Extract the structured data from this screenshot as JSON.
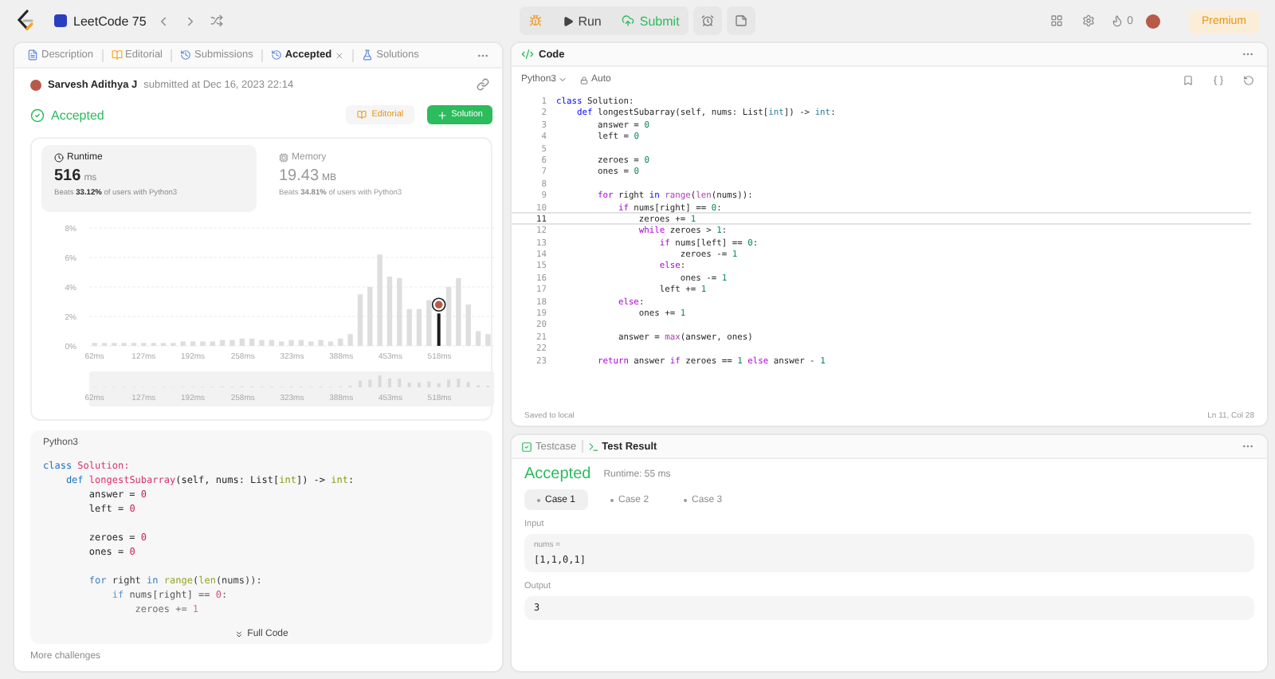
{
  "top_bar": {
    "title": "LeetCode 75",
    "run": "Run",
    "submit": "Submit",
    "streak": "0",
    "premium": "Premium"
  },
  "left_tabs": [
    {
      "label": "Description",
      "kind": "description",
      "selected": false,
      "closable": false
    },
    {
      "label": "Editorial",
      "kind": "editorial",
      "selected": false,
      "closable": false
    },
    {
      "label": "Submissions",
      "kind": "submissions",
      "selected": false,
      "closable": false
    },
    {
      "label": "Accepted",
      "kind": "accepted",
      "selected": true,
      "closable": true
    },
    {
      "label": "Solutions",
      "kind": "solutions",
      "selected": false,
      "closable": false
    }
  ],
  "submission": {
    "author": "Sarvesh Adithya J",
    "submitted": "submitted at Dec 16, 2023 22:14",
    "status": "Accepted",
    "editorial_button": "Editorial",
    "solution_button": "Solution"
  },
  "stats": [
    {
      "kind": "runtime",
      "label": "Runtime",
      "value": "516",
      "unit": "ms",
      "beats": "Beats **33.12%** of users with Python3",
      "selected": true
    },
    {
      "kind": "memory",
      "label": "Memory",
      "value": "19.43",
      "unit": "MB",
      "beats": "Beats **34.81%** of users with Python3",
      "selected": false
    }
  ],
  "runtime_chart": {
    "chart_data": {
      "type": "bar",
      "grid": true,
      "xlim": [
        55,
        590
      ],
      "ylim": [
        0,
        8
      ],
      "x": [
        62,
        75,
        88,
        101,
        114,
        127,
        140,
        153,
        166,
        179,
        192,
        205,
        218,
        231,
        244,
        257,
        270,
        283,
        296,
        309,
        322,
        335,
        348,
        361,
        374,
        387,
        400,
        413,
        426,
        439,
        452,
        465,
        478,
        491,
        504,
        517,
        530,
        543,
        556,
        569,
        582
      ],
      "series": [
        {
          "color": "#dedede",
          "values": [
            0.2,
            0.2,
            0.2,
            0.2,
            0.2,
            0.2,
            0.2,
            0.2,
            0.2,
            0.3,
            0.3,
            0.3,
            0.3,
            0.4,
            0.4,
            0.5,
            0.5,
            0.4,
            0.4,
            0.3,
            0.4,
            0.4,
            0.3,
            0.4,
            0.3,
            0.5,
            0.8,
            3.5,
            4.0,
            6.2,
            4.7,
            4.6,
            2.5,
            2.5,
            3.1,
            null,
            4.0,
            4.6,
            2.8,
            1.0,
            0.8
          ]
        },
        {
          "color": "#1a1a1a",
          "values": [
            null,
            null,
            null,
            null,
            null,
            null,
            null,
            null,
            null,
            null,
            null,
            null,
            null,
            null,
            null,
            null,
            null,
            null,
            null,
            null,
            null,
            null,
            null,
            null,
            null,
            null,
            null,
            null,
            null,
            null,
            null,
            null,
            null,
            null,
            null,
            2.2,
            null,
            null,
            null,
            null,
            null
          ]
        }
      ],
      "xticks": [
        {
          "value": 62,
          "label": "62ms"
        },
        {
          "value": 127,
          "label": "127ms"
        },
        {
          "value": 192,
          "label": "192ms"
        },
        {
          "value": 258,
          "label": "258ms"
        },
        {
          "value": 323,
          "label": "323ms"
        },
        {
          "value": 388,
          "label": "388ms"
        },
        {
          "value": 453,
          "label": "453ms"
        },
        {
          "value": 518,
          "label": "518ms"
        }
      ],
      "yticks": [
        {
          "value": 0,
          "label": "0%"
        },
        {
          "value": 2,
          "label": "2%"
        },
        {
          "value": 4,
          "label": "4%"
        },
        {
          "value": 6,
          "label": "6%"
        },
        {
          "value": 8,
          "label": "8%"
        }
      ]
    },
    "brush_labels": [
      "62ms",
      "127ms",
      "192ms",
      "258ms",
      "323ms",
      "388ms",
      "453ms",
      "518ms"
    ]
  },
  "snippet": {
    "language": "Python3",
    "expand_button": "Full Code",
    "lines": [
      {
        "kind": "code",
        "tokens": [
          {
            "text": "class",
            "kind": "keyword"
          },
          {
            "text": " Solution:",
            "kind": "class"
          }
        ]
      },
      {
        "kind": "code",
        "tokens": [
          {
            "text": "    def",
            "kind": "keyword"
          },
          {
            "text": " longestSubarray",
            "kind": "function"
          },
          {
            "text": "(self, nums: List[",
            "kind": "plain"
          },
          {
            "text": "int",
            "kind": "type"
          },
          {
            "text": "]) -> ",
            "kind": "plain"
          },
          {
            "text": "int",
            "kind": "type"
          },
          {
            "text": ":",
            "kind": "plain"
          }
        ]
      },
      {
        "kind": "code",
        "tokens": [
          {
            "text": "        answer = ",
            "kind": "plain"
          },
          {
            "text": "0",
            "kind": "number"
          }
        ]
      },
      {
        "kind": "code",
        "tokens": [
          {
            "text": "        left = ",
            "kind": "plain"
          },
          {
            "text": "0",
            "kind": "number"
          }
        ]
      },
      {
        "kind": "blank"
      },
      {
        "kind": "code",
        "tokens": [
          {
            "text": "        zeroes = ",
            "kind": "plain"
          },
          {
            "text": "0",
            "kind": "number"
          }
        ]
      },
      {
        "kind": "code",
        "tokens": [
          {
            "text": "        ones = ",
            "kind": "plain"
          },
          {
            "text": "0",
            "kind": "number"
          }
        ]
      },
      {
        "kind": "blank"
      },
      {
        "kind": "code",
        "tokens": [
          {
            "text": "        for",
            "kind": "control"
          },
          {
            "text": " right ",
            "kind": "plain"
          },
          {
            "text": "in",
            "kind": "control"
          },
          {
            "text": " range",
            "kind": "builtin"
          },
          {
            "text": "(",
            "kind": "plain"
          },
          {
            "text": "len",
            "kind": "builtin"
          },
          {
            "text": "(nums)):",
            "kind": "plain"
          }
        ]
      },
      {
        "kind": "code",
        "tokens": [
          {
            "text": "            if",
            "kind": "control"
          },
          {
            "text": " nums[right] == ",
            "kind": "plain"
          },
          {
            "text": "0",
            "kind": "number"
          },
          {
            "text": ":",
            "kind": "plain"
          }
        ]
      },
      {
        "kind": "code",
        "tokens": [
          {
            "text": "                zeroes += ",
            "kind": "plain"
          },
          {
            "text": "1",
            "kind": "number"
          }
        ]
      }
    ]
  },
  "more_link": "More challenges",
  "editor": {
    "title": "Code",
    "language": "Python3",
    "mode": "Auto",
    "status": "Saved to local",
    "cursor": "Ln 11, Col 28",
    "lines": [
      {
        "no": "1",
        "current": false,
        "tokens": [
          {
            "text": "class",
            "kind": "keyword"
          },
          {
            "text": " Solution:",
            "kind": "plain"
          }
        ]
      },
      {
        "no": "2",
        "current": false,
        "tokens": [
          {
            "text": "    def",
            "kind": "keyword"
          },
          {
            "text": " longestSubarray(self, nums: List[",
            "kind": "plain"
          },
          {
            "text": "int",
            "kind": "type"
          },
          {
            "text": "]) -> ",
            "kind": "plain"
          },
          {
            "text": "int",
            "kind": "type"
          },
          {
            "text": ":",
            "kind": "plain"
          }
        ]
      },
      {
        "no": "3",
        "current": false,
        "tokens": [
          {
            "text": "        answer = ",
            "kind": "plain"
          },
          {
            "text": "0",
            "kind": "number"
          }
        ]
      },
      {
        "no": "4",
        "current": false,
        "tokens": [
          {
            "text": "        left = ",
            "kind": "plain"
          },
          {
            "text": "0",
            "kind": "number"
          }
        ]
      },
      {
        "no": "5",
        "current": false
      },
      {
        "no": "6",
        "current": false,
        "tokens": [
          {
            "text": "        zeroes = ",
            "kind": "plain"
          },
          {
            "text": "0",
            "kind": "number"
          }
        ]
      },
      {
        "no": "7",
        "current": false,
        "tokens": [
          {
            "text": "        ones = ",
            "kind": "plain"
          },
          {
            "text": "0",
            "kind": "number"
          }
        ]
      },
      {
        "no": "8",
        "current": false
      },
      {
        "no": "9",
        "current": false,
        "tokens": [
          {
            "text": "        for",
            "kind": "control"
          },
          {
            "text": " right ",
            "kind": "plain"
          },
          {
            "text": "in",
            "kind": "keyword"
          },
          {
            "text": " range",
            "kind": "builtin"
          },
          {
            "text": "(",
            "kind": "plain"
          },
          {
            "text": "len",
            "kind": "builtin"
          },
          {
            "text": "(nums)):",
            "kind": "plain"
          }
        ]
      },
      {
        "no": "10",
        "current": false,
        "tokens": [
          {
            "text": "            if",
            "kind": "control"
          },
          {
            "text": " nums[right] == ",
            "kind": "plain"
          },
          {
            "text": "0",
            "kind": "number"
          },
          {
            "text": ":",
            "kind": "plain"
          }
        ]
      },
      {
        "no": "11",
        "current": true,
        "tokens": [
          {
            "text": "                zeroes += ",
            "kind": "plain"
          },
          {
            "text": "1",
            "kind": "number"
          }
        ]
      },
      {
        "no": "12",
        "current": false,
        "tokens": [
          {
            "text": "                while",
            "kind": "control"
          },
          {
            "text": " zeroes > ",
            "kind": "plain"
          },
          {
            "text": "1",
            "kind": "number"
          },
          {
            "text": ":",
            "kind": "plain"
          }
        ]
      },
      {
        "no": "13",
        "current": false,
        "tokens": [
          {
            "text": "                    if",
            "kind": "control"
          },
          {
            "text": " nums[left] == ",
            "kind": "plain"
          },
          {
            "text": "0",
            "kind": "number"
          },
          {
            "text": ":",
            "kind": "plain"
          }
        ]
      },
      {
        "no": "14",
        "current": false,
        "tokens": [
          {
            "text": "                        zeroes -= ",
            "kind": "plain"
          },
          {
            "text": "1",
            "kind": "number"
          }
        ]
      },
      {
        "no": "15",
        "current": false,
        "tokens": [
          {
            "text": "                    else",
            "kind": "control"
          },
          {
            "text": ":",
            "kind": "plain"
          }
        ]
      },
      {
        "no": "16",
        "current": false,
        "tokens": [
          {
            "text": "                        ones -= ",
            "kind": "plain"
          },
          {
            "text": "1",
            "kind": "number"
          }
        ]
      },
      {
        "no": "17",
        "current": false,
        "tokens": [
          {
            "text": "                    left += ",
            "kind": "plain"
          },
          {
            "text": "1",
            "kind": "number"
          }
        ]
      },
      {
        "no": "18",
        "current": false,
        "tokens": [
          {
            "text": "            else",
            "kind": "control"
          },
          {
            "text": ":",
            "kind": "plain"
          }
        ]
      },
      {
        "no": "19",
        "current": false,
        "tokens": [
          {
            "text": "                ones += ",
            "kind": "plain"
          },
          {
            "text": "1",
            "kind": "number"
          }
        ]
      },
      {
        "no": "20",
        "current": false
      },
      {
        "no": "21",
        "current": false,
        "tokens": [
          {
            "text": "            answer = ",
            "kind": "plain"
          },
          {
            "text": "max",
            "kind": "builtin"
          },
          {
            "text": "(answer, ones)",
            "kind": "plain"
          }
        ]
      },
      {
        "no": "22",
        "current": false
      },
      {
        "no": "23",
        "current": false,
        "tokens": [
          {
            "text": "        return",
            "kind": "control"
          },
          {
            "text": " answer ",
            "kind": "plain"
          },
          {
            "text": "if",
            "kind": "control"
          },
          {
            "text": " zeroes == ",
            "kind": "plain"
          },
          {
            "text": "1",
            "kind": "number"
          },
          {
            "text": " else",
            "kind": "control"
          },
          {
            "text": " answer - ",
            "kind": "plain"
          },
          {
            "text": "1",
            "kind": "number"
          }
        ]
      }
    ]
  },
  "console": {
    "tabs": [
      {
        "label": "Testcase",
        "kind": "testcase",
        "selected": false
      },
      {
        "label": "Test Result",
        "kind": "result",
        "selected": true
      }
    ],
    "verdict": "Accepted",
    "runtime": "Runtime: 55 ms",
    "cases": [
      {
        "label": "Case 1",
        "selected": true
      },
      {
        "label": "Case 2",
        "selected": false
      },
      {
        "label": "Case 3",
        "selected": false
      }
    ],
    "input_label": "Input",
    "inputs": [
      {
        "name": "nums =",
        "value": "[1,1,0,1]"
      }
    ],
    "output_label": "Output",
    "output": "3"
  }
}
